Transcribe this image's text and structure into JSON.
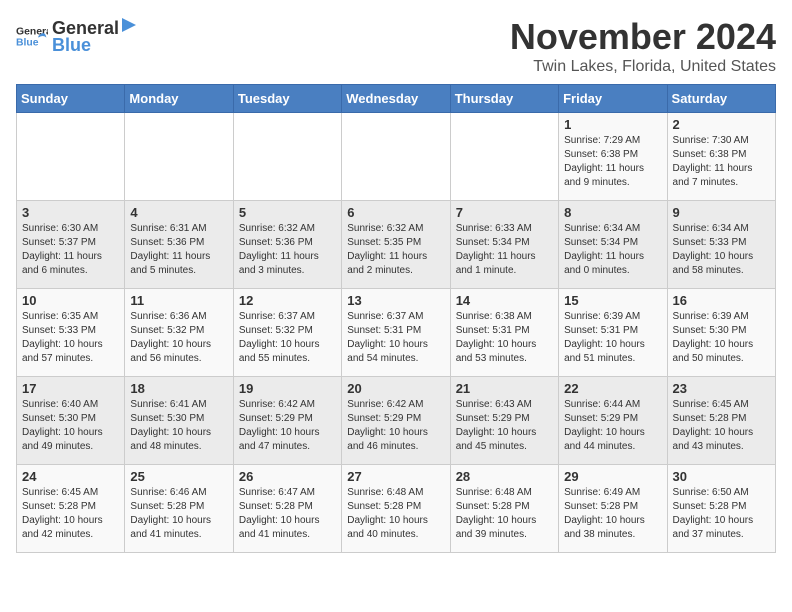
{
  "logo": {
    "general": "General",
    "blue": "Blue"
  },
  "title": "November 2024",
  "subtitle": "Twin Lakes, Florida, United States",
  "days_header": [
    "Sunday",
    "Monday",
    "Tuesday",
    "Wednesday",
    "Thursday",
    "Friday",
    "Saturday"
  ],
  "weeks": [
    [
      {
        "day": "",
        "info": ""
      },
      {
        "day": "",
        "info": ""
      },
      {
        "day": "",
        "info": ""
      },
      {
        "day": "",
        "info": ""
      },
      {
        "day": "",
        "info": ""
      },
      {
        "day": "1",
        "info": "Sunrise: 7:29 AM\nSunset: 6:38 PM\nDaylight: 11 hours and 9 minutes."
      },
      {
        "day": "2",
        "info": "Sunrise: 7:30 AM\nSunset: 6:38 PM\nDaylight: 11 hours and 7 minutes."
      }
    ],
    [
      {
        "day": "3",
        "info": "Sunrise: 6:30 AM\nSunset: 5:37 PM\nDaylight: 11 hours and 6 minutes."
      },
      {
        "day": "4",
        "info": "Sunrise: 6:31 AM\nSunset: 5:36 PM\nDaylight: 11 hours and 5 minutes."
      },
      {
        "day": "5",
        "info": "Sunrise: 6:32 AM\nSunset: 5:36 PM\nDaylight: 11 hours and 3 minutes."
      },
      {
        "day": "6",
        "info": "Sunrise: 6:32 AM\nSunset: 5:35 PM\nDaylight: 11 hours and 2 minutes."
      },
      {
        "day": "7",
        "info": "Sunrise: 6:33 AM\nSunset: 5:34 PM\nDaylight: 11 hours and 1 minute."
      },
      {
        "day": "8",
        "info": "Sunrise: 6:34 AM\nSunset: 5:34 PM\nDaylight: 11 hours and 0 minutes."
      },
      {
        "day": "9",
        "info": "Sunrise: 6:34 AM\nSunset: 5:33 PM\nDaylight: 10 hours and 58 minutes."
      }
    ],
    [
      {
        "day": "10",
        "info": "Sunrise: 6:35 AM\nSunset: 5:33 PM\nDaylight: 10 hours and 57 minutes."
      },
      {
        "day": "11",
        "info": "Sunrise: 6:36 AM\nSunset: 5:32 PM\nDaylight: 10 hours and 56 minutes."
      },
      {
        "day": "12",
        "info": "Sunrise: 6:37 AM\nSunset: 5:32 PM\nDaylight: 10 hours and 55 minutes."
      },
      {
        "day": "13",
        "info": "Sunrise: 6:37 AM\nSunset: 5:31 PM\nDaylight: 10 hours and 54 minutes."
      },
      {
        "day": "14",
        "info": "Sunrise: 6:38 AM\nSunset: 5:31 PM\nDaylight: 10 hours and 53 minutes."
      },
      {
        "day": "15",
        "info": "Sunrise: 6:39 AM\nSunset: 5:31 PM\nDaylight: 10 hours and 51 minutes."
      },
      {
        "day": "16",
        "info": "Sunrise: 6:39 AM\nSunset: 5:30 PM\nDaylight: 10 hours and 50 minutes."
      }
    ],
    [
      {
        "day": "17",
        "info": "Sunrise: 6:40 AM\nSunset: 5:30 PM\nDaylight: 10 hours and 49 minutes."
      },
      {
        "day": "18",
        "info": "Sunrise: 6:41 AM\nSunset: 5:30 PM\nDaylight: 10 hours and 48 minutes."
      },
      {
        "day": "19",
        "info": "Sunrise: 6:42 AM\nSunset: 5:29 PM\nDaylight: 10 hours and 47 minutes."
      },
      {
        "day": "20",
        "info": "Sunrise: 6:42 AM\nSunset: 5:29 PM\nDaylight: 10 hours and 46 minutes."
      },
      {
        "day": "21",
        "info": "Sunrise: 6:43 AM\nSunset: 5:29 PM\nDaylight: 10 hours and 45 minutes."
      },
      {
        "day": "22",
        "info": "Sunrise: 6:44 AM\nSunset: 5:29 PM\nDaylight: 10 hours and 44 minutes."
      },
      {
        "day": "23",
        "info": "Sunrise: 6:45 AM\nSunset: 5:28 PM\nDaylight: 10 hours and 43 minutes."
      }
    ],
    [
      {
        "day": "24",
        "info": "Sunrise: 6:45 AM\nSunset: 5:28 PM\nDaylight: 10 hours and 42 minutes."
      },
      {
        "day": "25",
        "info": "Sunrise: 6:46 AM\nSunset: 5:28 PM\nDaylight: 10 hours and 41 minutes."
      },
      {
        "day": "26",
        "info": "Sunrise: 6:47 AM\nSunset: 5:28 PM\nDaylight: 10 hours and 41 minutes."
      },
      {
        "day": "27",
        "info": "Sunrise: 6:48 AM\nSunset: 5:28 PM\nDaylight: 10 hours and 40 minutes."
      },
      {
        "day": "28",
        "info": "Sunrise: 6:48 AM\nSunset: 5:28 PM\nDaylight: 10 hours and 39 minutes."
      },
      {
        "day": "29",
        "info": "Sunrise: 6:49 AM\nSunset: 5:28 PM\nDaylight: 10 hours and 38 minutes."
      },
      {
        "day": "30",
        "info": "Sunrise: 6:50 AM\nSunset: 5:28 PM\nDaylight: 10 hours and 37 minutes."
      }
    ]
  ]
}
